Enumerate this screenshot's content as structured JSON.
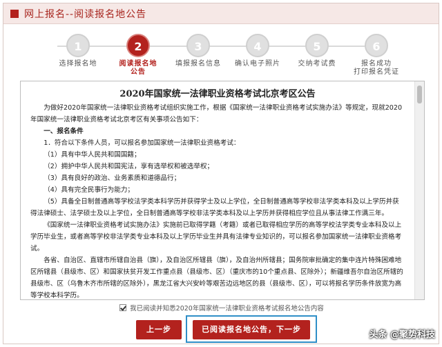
{
  "header": {
    "title": "网上报名--阅读报名地公告"
  },
  "steps": [
    {
      "num": "1",
      "label1": "选择报名地",
      "label2": ""
    },
    {
      "num": "2",
      "label1": "阅读报名地",
      "label2": "公告"
    },
    {
      "num": "3",
      "label1": "填报报名信息",
      "label2": ""
    },
    {
      "num": "4",
      "label1": "确认电子照片",
      "label2": ""
    },
    {
      "num": "5",
      "label1": "交纳考试费",
      "label2": ""
    },
    {
      "num": "6",
      "label1": "报名成功",
      "label2": "打印报名凭证"
    }
  ],
  "notice": {
    "title": "2020年国家统一法律职业资格考试北京考区公告",
    "p1": "为做好2020年国家统一法律职业资格考试组织实施工作，根据《国家统一法律职业资格考试实施办法》等规定，现就2020年国家统一法律职业资格考试北京考区有关事项公告如下：",
    "s1": "一、报名条件",
    "p2": "1．符合以下条件人员，可以报名参加国家统一法律职业资格考试：",
    "c1": "（1）具有中华人民共和国国籍；",
    "c2": "（2）拥护中华人民共和国宪法，享有选举权和被选举权；",
    "c3": "（3）具有良好的政治、业务素质和道德品行；",
    "c4": "（4）具有完全民事行为能力；",
    "c5": "（5）具备全日制普通高等学校法学类本科学历并获得学士及以上学位，全日制普通高等学校非法学类本科及以上学历并获得法律硕士、法学硕士及以上学位，全日制普通高等学校非法学类本科及以上学历并获得相应学位且从事法律工作满三年。",
    "p3": "《国家统一法律职业资格考试实施办法》实施前已取得学籍（考籍）或者已取得相应学历的高等学校法学类专业本科及以上学历毕业生，或者高等学校非法学类专业本科及以上学历毕业生并具有法律专业知识的，可以报名参加国家统一法律职业资格考试。",
    "p4": "各省、自治区、直辖市所辖自治县（旗），及自治区所辖县（旗），及自治州所辖县；国务院审批确定的集中连片特殊困难地区所辖县（县级市、区）和国家扶贫开发工作重点县（县级市、区）（重庆市的10个重点县、区除外）；新疆维吾尔自治区所辖的县级市、区（乌鲁木齐市所辖的区除外），黑龙江省大兴安岭等艰苦边远地区的县（县级市、区），可以将报名学历条件放宽为高等学校本科学历。"
  },
  "agree_text": "我已阅读并知悉2020年国家统一法律职业资格考试报名地公告内容",
  "buttons": {
    "prev": "上一步",
    "next": "已阅读报名地公告，下一步"
  },
  "watermark": "头条 @聚势科技"
}
